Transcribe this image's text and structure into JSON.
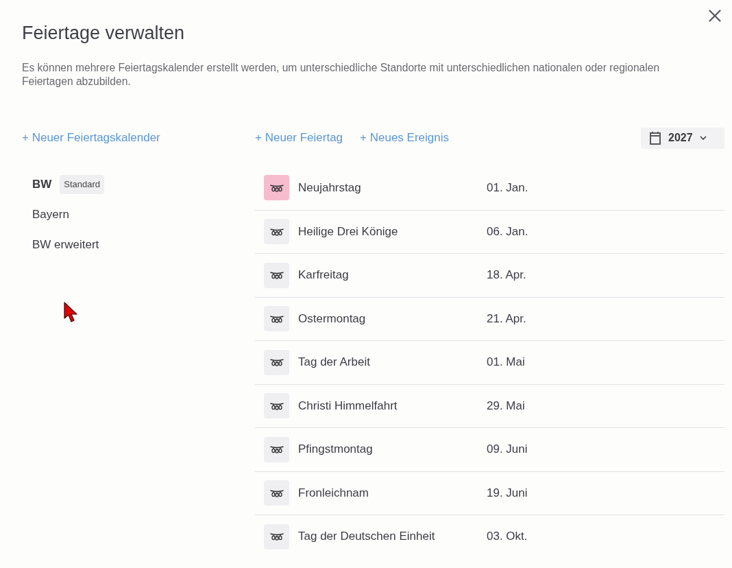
{
  "dialog": {
    "title": "Feiertage verwalten",
    "description": "Es können mehrere Feiertagskalender erstellt werden, um unterschiedliche Standorte mit unterschiedlichen nationalen oder regionalen Feiertagen abzubilden."
  },
  "sidebar": {
    "action": "+ Neuer Feiertagskalender",
    "items": [
      {
        "label": "BW",
        "selected": true,
        "badge": "Standard"
      },
      {
        "label": "Bayern",
        "selected": false
      },
      {
        "label": "BW erweitert",
        "selected": false
      }
    ]
  },
  "toolbar": {
    "actions": [
      "+ Neuer Feiertag",
      "+ Neues Ereignis"
    ],
    "year": "2027"
  },
  "holidays": [
    {
      "name": "Neujahrstag",
      "date": "01. Jan.",
      "highlighted": true
    },
    {
      "name": "Heilige Drei Könige",
      "date": "06. Jan.",
      "highlighted": false
    },
    {
      "name": "Karfreitag",
      "date": "18. Apr.",
      "highlighted": false
    },
    {
      "name": "Ostermontag",
      "date": "21. Apr.",
      "highlighted": false
    },
    {
      "name": "Tag der Arbeit",
      "date": "01. Mai",
      "highlighted": false
    },
    {
      "name": "Christi Himmelfahrt",
      "date": "29. Mai",
      "highlighted": false
    },
    {
      "name": "Pfingstmontag",
      "date": "09. Juni",
      "highlighted": false
    },
    {
      "name": "Fronleichnam",
      "date": "19. Juni",
      "highlighted": false
    },
    {
      "name": "Tag der Deutschen Einheit",
      "date": "03. Okt.",
      "highlighted": false
    }
  ]
}
